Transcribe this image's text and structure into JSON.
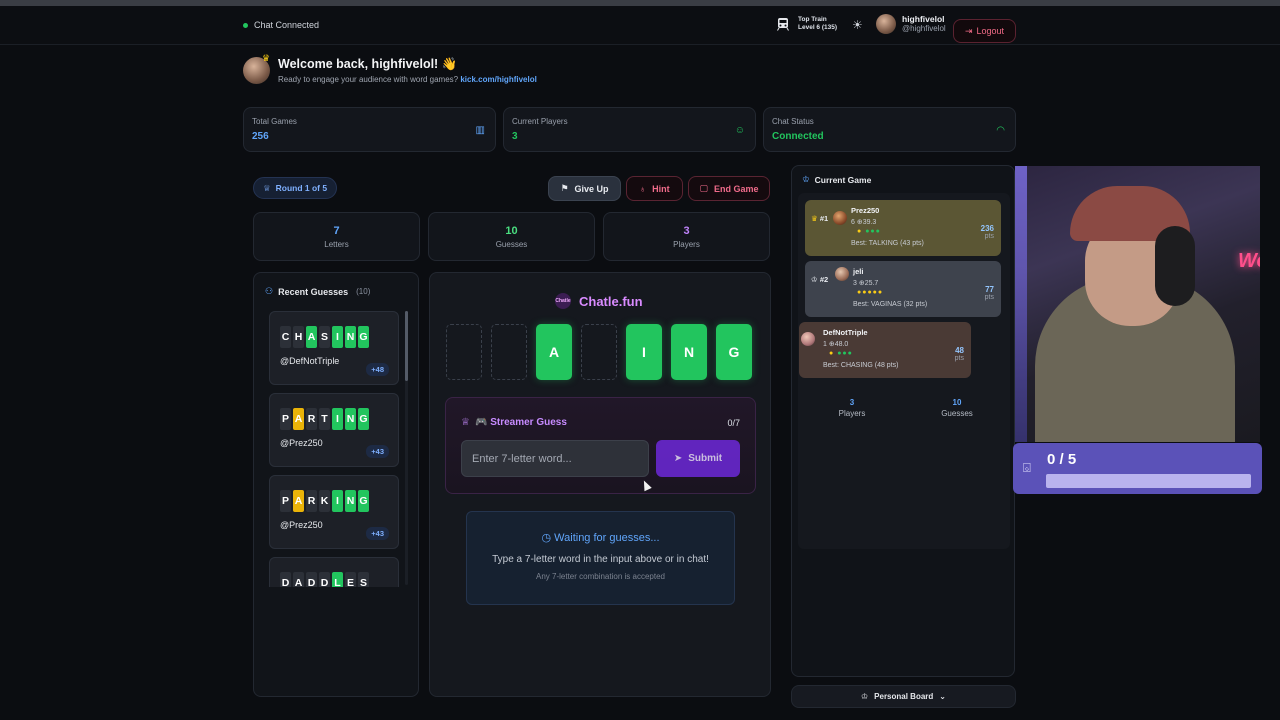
{
  "header": {
    "chat_status": "Chat Connected",
    "top_train_title": "Top Train",
    "top_train_level": "Level 6 (135)",
    "user_name": "highfivelol",
    "user_handle": "@highfivelol",
    "logout_label": "Logout"
  },
  "welcome": {
    "title": "Welcome back, highfivelol! 👋",
    "subtitle": "Ready to engage your audience with word games?",
    "link": "kick.com/highfivelol"
  },
  "stats": [
    {
      "label": "Total Games",
      "value": "256",
      "color": "#60a5fa",
      "icon": "bar-chart-icon"
    },
    {
      "label": "Current Players",
      "value": "3",
      "color": "#22c55e",
      "icon": "user-icon"
    },
    {
      "label": "Chat Status",
      "value": "Connected",
      "color": "#22c55e",
      "icon": "wifi-icon"
    }
  ],
  "controls": {
    "round": "Round 1 of 5",
    "give_up": "Give Up",
    "hint": "Hint",
    "end_game": "End Game"
  },
  "summary": [
    {
      "value": "7",
      "label": "Letters",
      "color": "#60a5fa"
    },
    {
      "value": "10",
      "label": "Guesses",
      "color": "#4ade80"
    },
    {
      "value": "3",
      "label": "Players",
      "color": "#c084fc"
    }
  ],
  "recent": {
    "title": "Recent Guesses",
    "count": "(10)",
    "items": [
      {
        "letters": [
          "C",
          "H",
          "A",
          "S",
          "I",
          "N",
          "G"
        ],
        "states": [
          "n",
          "n",
          "g",
          "n",
          "g",
          "g",
          "g"
        ],
        "user": "@DefNotTriple",
        "points": "+48"
      },
      {
        "letters": [
          "P",
          "A",
          "R",
          "T",
          "I",
          "N",
          "G"
        ],
        "states": [
          "n",
          "y",
          "n",
          "n",
          "g",
          "g",
          "g"
        ],
        "user": "@Prez250",
        "points": "+43"
      },
      {
        "letters": [
          "P",
          "A",
          "R",
          "K",
          "I",
          "N",
          "G"
        ],
        "states": [
          "n",
          "y",
          "n",
          "n",
          "g",
          "g",
          "g"
        ],
        "user": "@Prez250",
        "points": "+43"
      },
      {
        "letters": [
          "D",
          "A",
          "D",
          "D",
          "L",
          "E",
          "S"
        ],
        "states": [
          "n",
          "n",
          "n",
          "n",
          "g",
          "n",
          "n"
        ],
        "user": "",
        "points": ""
      }
    ]
  },
  "game": {
    "brand": "Chatle.fun",
    "brand_logo": "Chatle",
    "board": [
      "",
      "",
      "A",
      "",
      "I",
      "N",
      "G"
    ],
    "streamer_title": "🎮 Streamer Guess",
    "streamer_count": "0/7",
    "input_placeholder": "Enter 7-letter word...",
    "submit_label": "Submit",
    "waiting_title": "Waiting for guesses...",
    "waiting_text": "Type a 7-letter word in the input above or in chat!",
    "waiting_note": "Any 7-letter combination is accepted"
  },
  "current_game": {
    "title": "Current Game",
    "players": [
      {
        "rank": "#1",
        "name": "Prez250",
        "meta": "6 ⊕39.3",
        "best": "Best: TALKING (43 pts)",
        "points": "236",
        "unit": "pts"
      },
      {
        "rank": "#2",
        "name": "jeli",
        "meta": "3 ⊕25.7",
        "best": "Best: VAGINAS (32 pts)",
        "points": "77",
        "unit": "pts"
      },
      {
        "rank": "",
        "name": "DefNotTriple",
        "meta": "1 ⊕48.0",
        "best": "Best: CHASING (48 pts)",
        "points": "48",
        "unit": "pts"
      }
    ],
    "footer_players_value": "3",
    "footer_players_label": "Players",
    "footer_guesses_value": "10",
    "footer_guesses_label": "Guesses",
    "personal_board": "Personal Board"
  },
  "goal": {
    "value": "0 / 5",
    "progress": 0
  }
}
